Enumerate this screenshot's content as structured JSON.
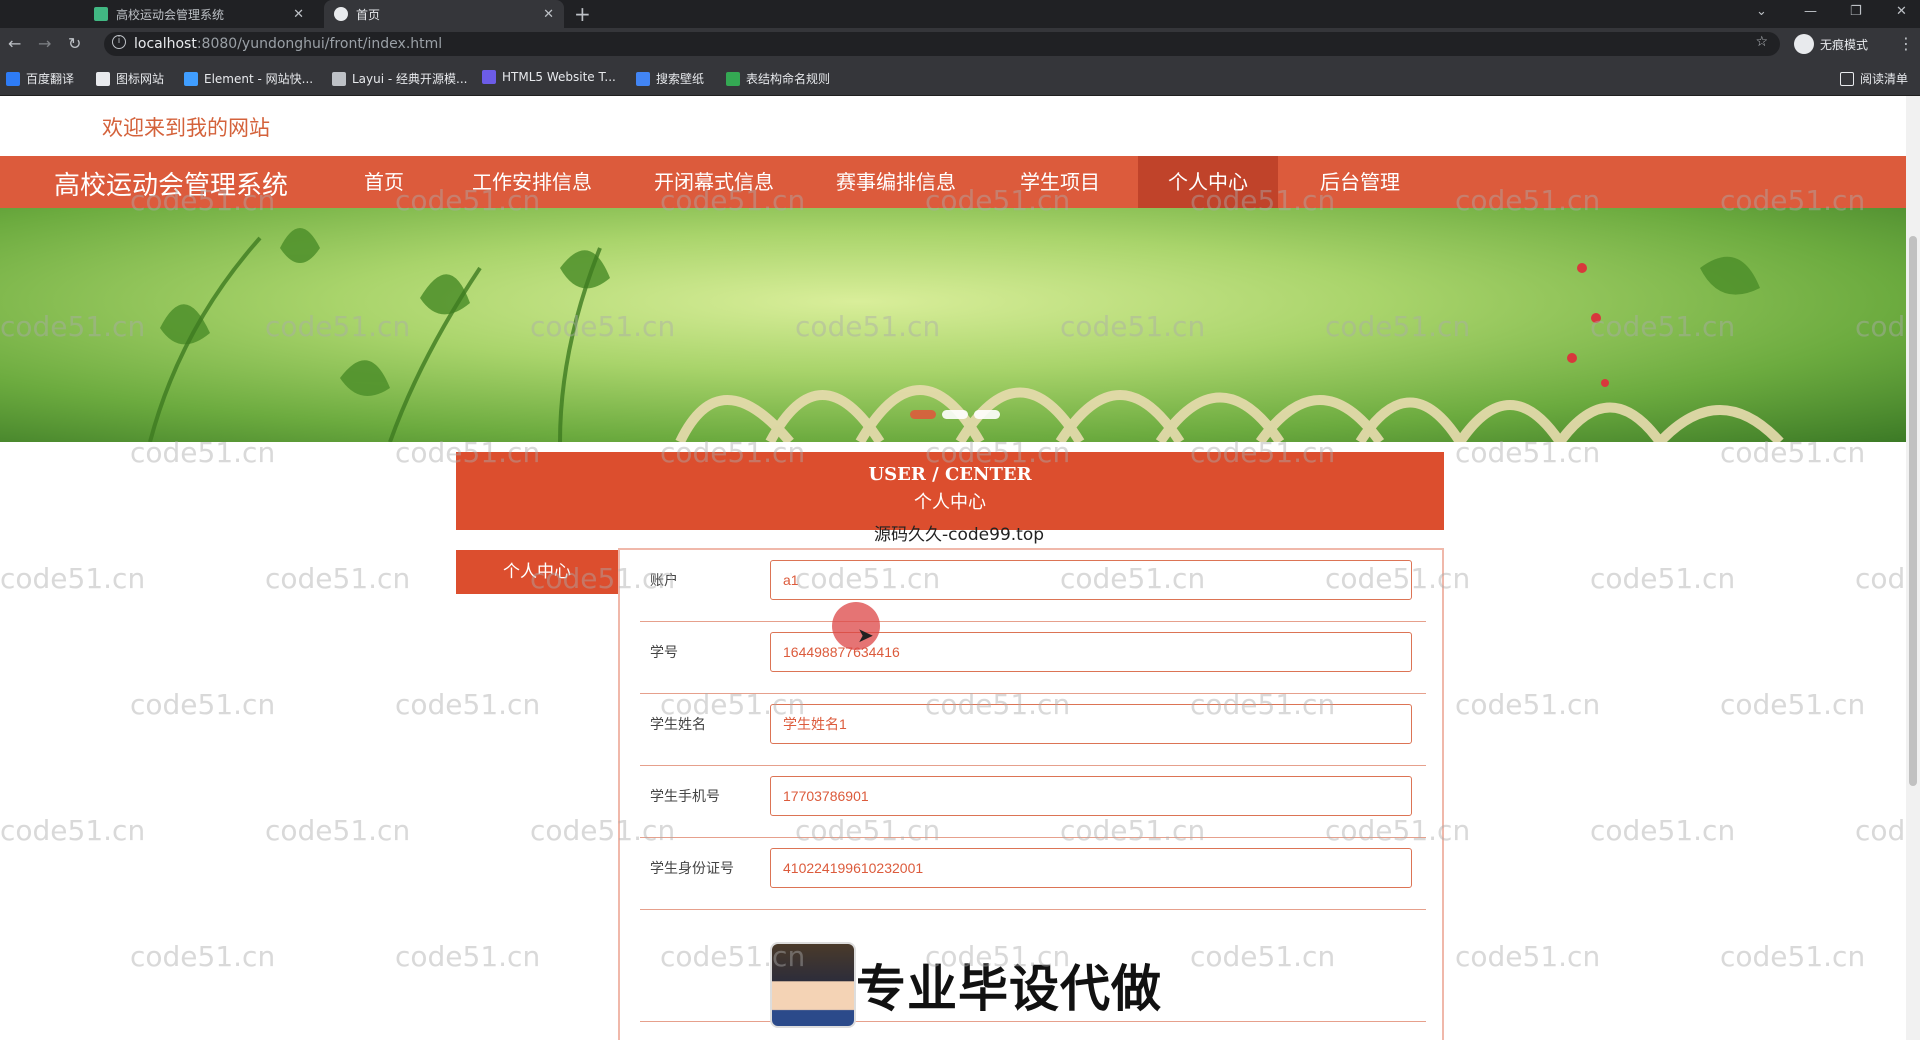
{
  "browser": {
    "tabs": [
      {
        "title": "高校运动会管理系统",
        "active": false
      },
      {
        "title": "首页",
        "active": true
      }
    ],
    "new_tab_label": "+",
    "url_host": "localhost",
    "url_path": ":8080/yundonghui/front/index.html",
    "profile_label": "无痕模式",
    "reading_list_label": "阅读清单",
    "bookmarks": [
      "百度翻译",
      "图标网站",
      "Element - 网站快...",
      "Layui - 经典开源模...",
      "HTML5 Website T...",
      "搜索壁纸",
      "表结构命名规则"
    ]
  },
  "site": {
    "welcome": "欢迎来到我的网站",
    "brand": "高校运动会管理系统",
    "nav": [
      "首页",
      "工作安排信息",
      "开闭幕式信息",
      "赛事编排信息",
      "学生项目",
      "个人中心",
      "后台管理"
    ],
    "nav_active_index": 5,
    "colors": {
      "accent": "#dc5b3c",
      "header": "#dc4e2e"
    }
  },
  "user_center": {
    "title_en": "USER / CENTER",
    "title_zh": "个人中心",
    "overlay_text": "源码久久-code99.top",
    "side_menu": "个人中心",
    "fields": [
      {
        "label": "账户",
        "value": "a1"
      },
      {
        "label": "学号",
        "value": "164498877634416"
      },
      {
        "label": "学生姓名",
        "value": "学生姓名1"
      },
      {
        "label": "学生手机号",
        "value": "17703786901"
      },
      {
        "label": "学生身份证号",
        "value": "410224199610232001"
      }
    ]
  },
  "advert": {
    "text": "专业毕设代做"
  },
  "watermark": "code51.cn"
}
